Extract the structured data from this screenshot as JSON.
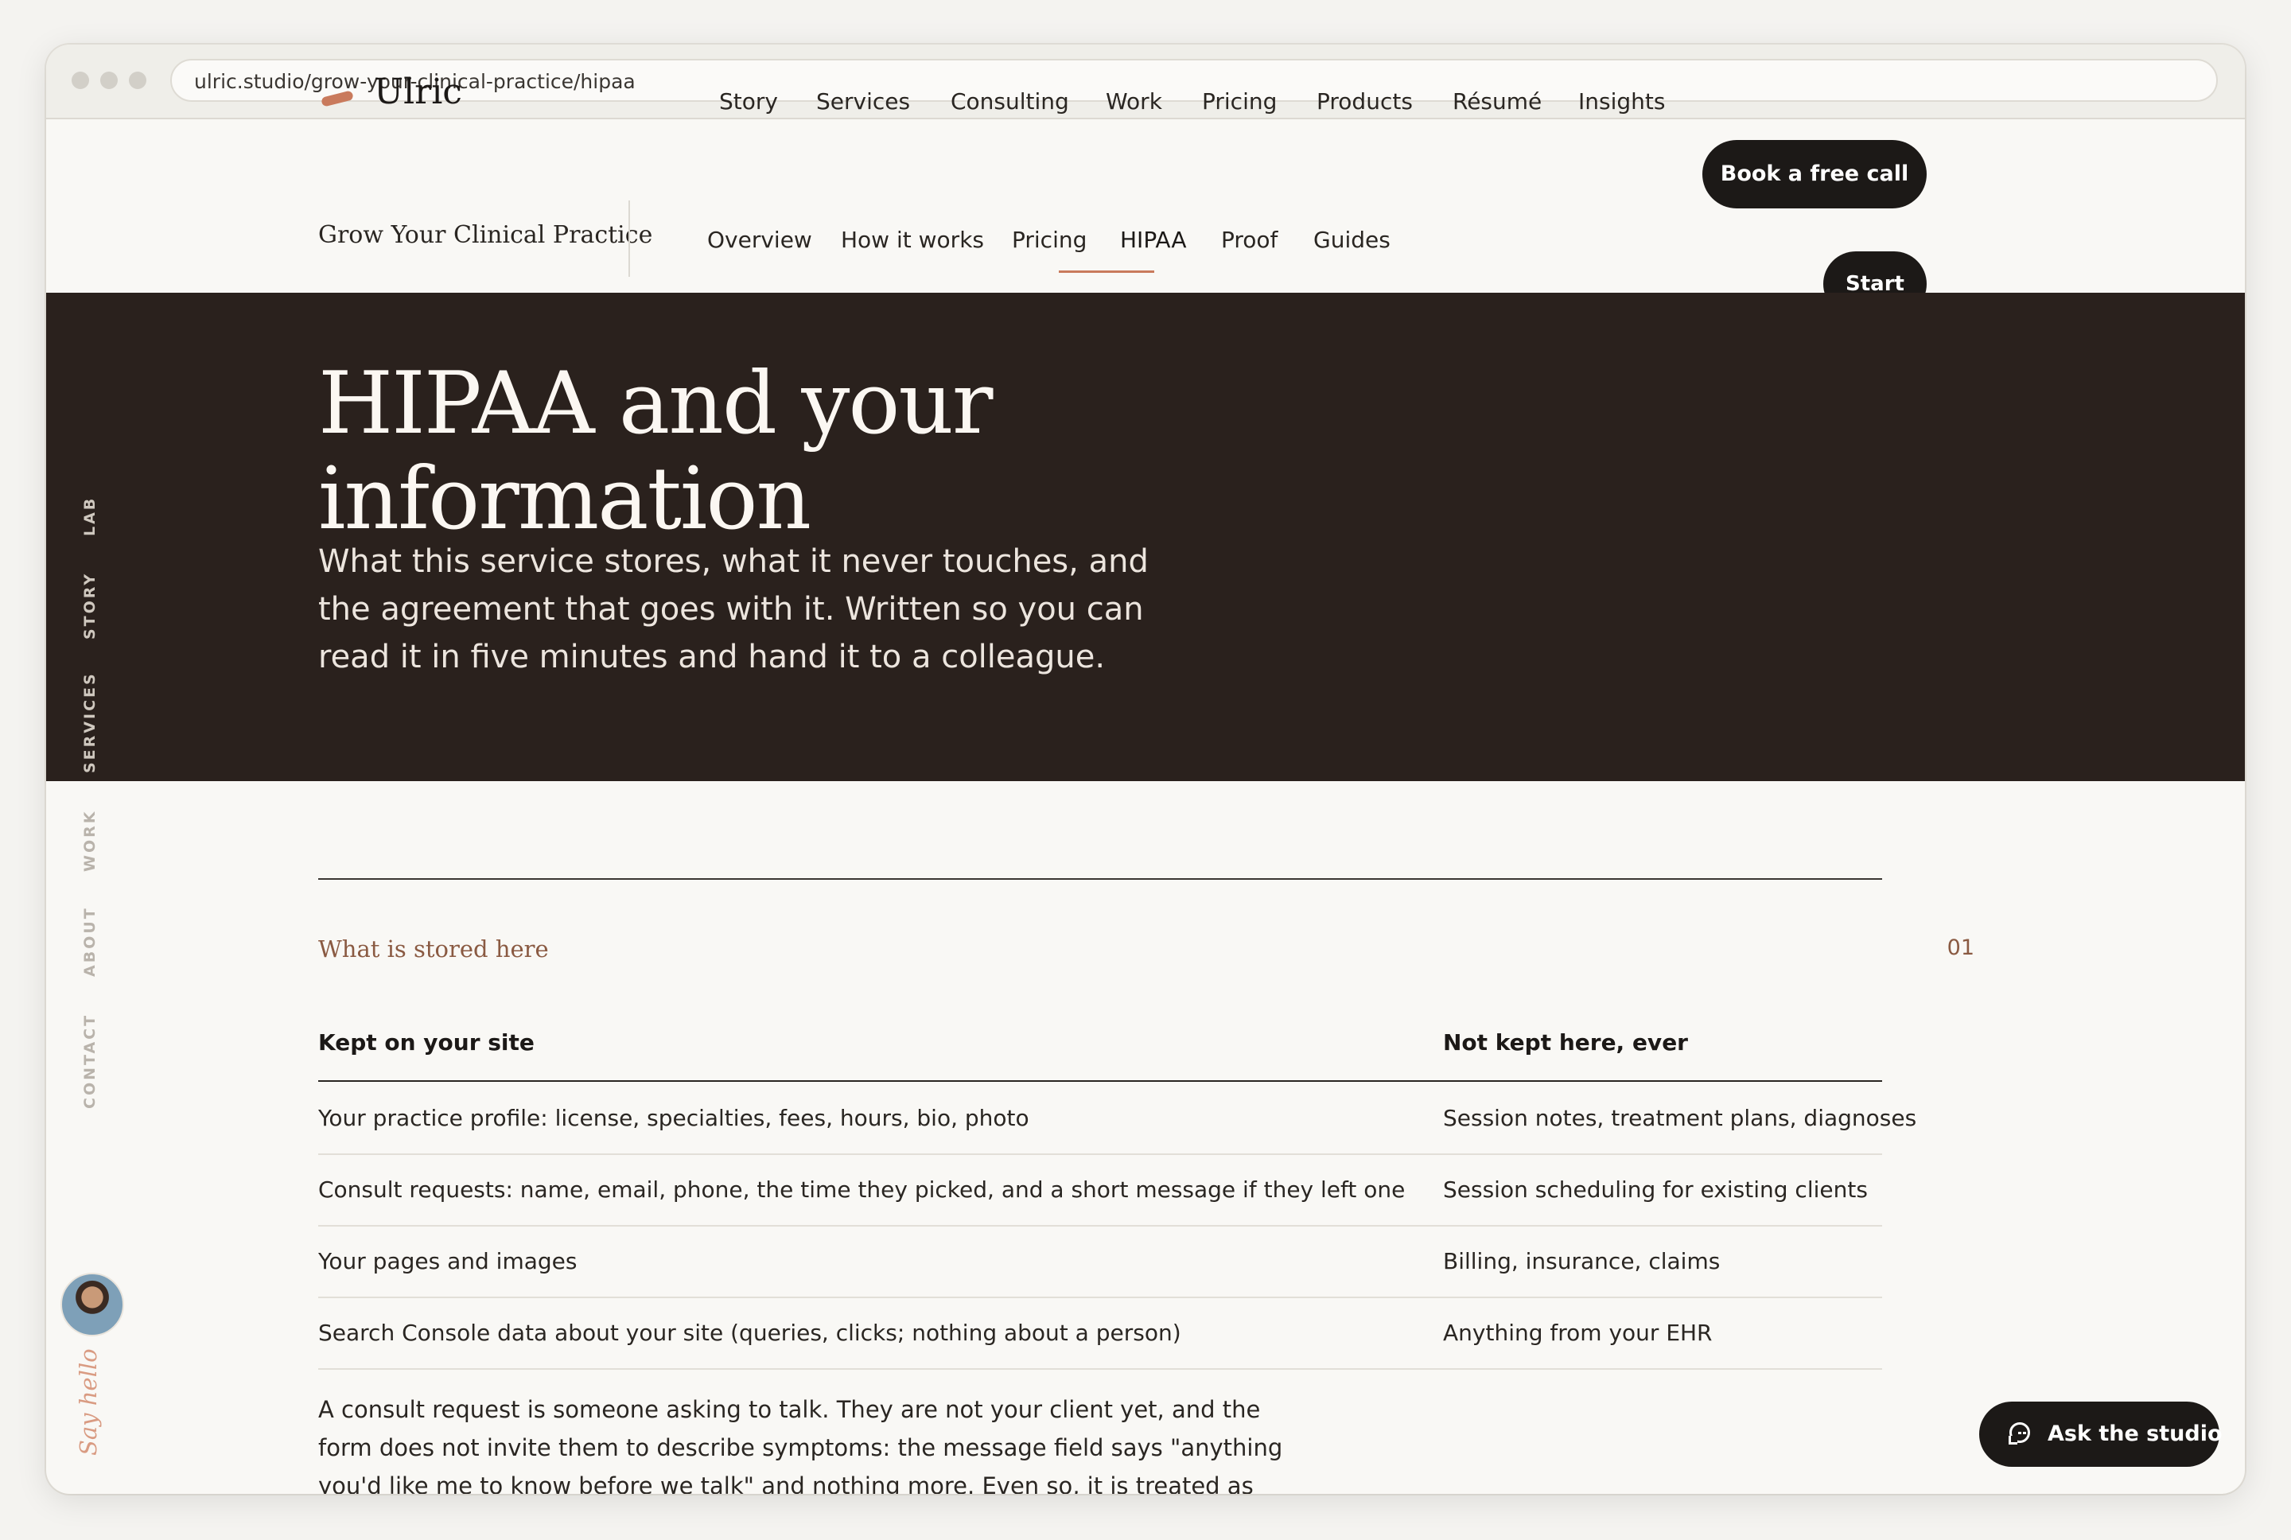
{
  "browser": {
    "url": "ulric.studio/grow-your-clinical-practice/hipaa"
  },
  "header": {
    "logo_text": "Ulric",
    "nav": [
      "Story",
      "Services",
      "Consulting",
      "Work",
      "Pricing",
      "Products",
      "Résumé",
      "Insights"
    ],
    "cta_label": "Book a free call"
  },
  "subnav": {
    "title": "Grow Your Clinical Practice",
    "items": [
      "Overview",
      "How it works",
      "Pricing",
      "HIPAA",
      "Proof",
      "Guides"
    ],
    "active": "HIPAA",
    "start_label": "Start"
  },
  "hero": {
    "title_line1": "HIPAA and your",
    "title_line2": "information",
    "subtitle": "What this service stores, what it never touches, and the agreement that goes with it. Written so you can read it in five minutes and hand it to a colleague."
  },
  "side_rail": {
    "items": [
      "LAB",
      "STORY",
      "SERVICES",
      "WORK",
      "ABOUT",
      "CONTACT"
    ],
    "say_hello": "Say hello"
  },
  "section": {
    "label": "What is stored here",
    "number": "01",
    "table": {
      "headers": [
        "Kept on your site",
        "Not kept here, ever"
      ],
      "rows": [
        [
          "Your practice profile: license, specialties, fees, hours, bio, photo",
          "Session notes, treatment plans, diagnoses"
        ],
        [
          "Consult requests: name, email, phone, the time they picked, and a short message if they left one",
          "Session scheduling for existing clients"
        ],
        [
          "Your pages and images",
          "Billing, insurance, claims"
        ],
        [
          "Search Console data about your site (queries, clicks; nothing about a person)",
          "Anything from your EHR"
        ]
      ]
    },
    "paragraph": "A consult request is someone asking to talk. They are not your client yet, and the form does not invite them to describe symptoms: the message field says \"anything you'd like me to know before we talk\" and nothing more. Even so, it is treated as"
  },
  "chat": {
    "label": "Ask the studio"
  },
  "colors": {
    "accent": "#c97a5c",
    "hero_bg": "#2a211d",
    "dark": "#1c1917"
  }
}
